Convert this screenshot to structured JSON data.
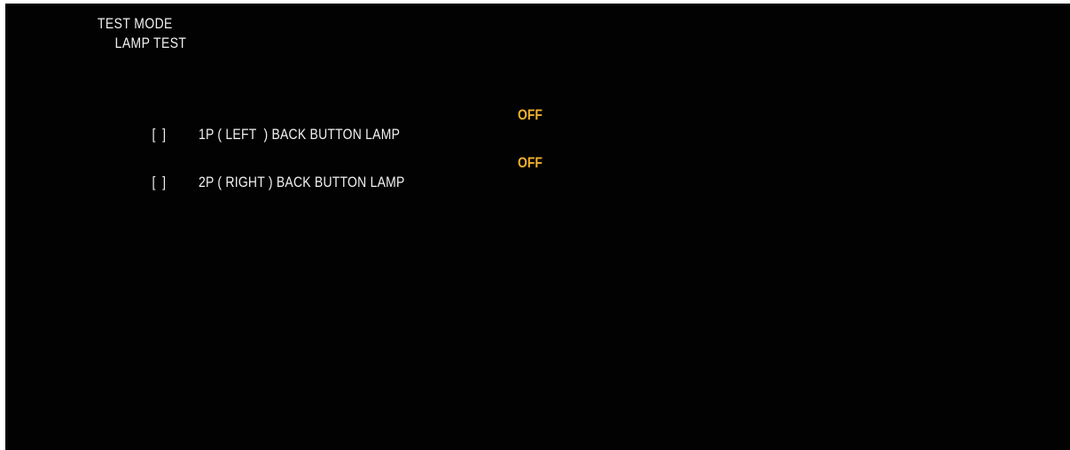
{
  "header": {
    "mode_title": "TEST MODE",
    "sub_title": "LAMP TEST"
  },
  "lamps": [
    {
      "cursor": "[  ]",
      "label": "1P ( LEFT  ) BACK BUTTON LAMP",
      "state": "OFF"
    },
    {
      "cursor": "[  ]",
      "label": "2P ( RIGHT ) BACK BUTTON LAMP",
      "state": "OFF"
    }
  ],
  "colors": {
    "background": "#020202",
    "text": "#f2f2f2",
    "state_off": "#f0b030"
  }
}
